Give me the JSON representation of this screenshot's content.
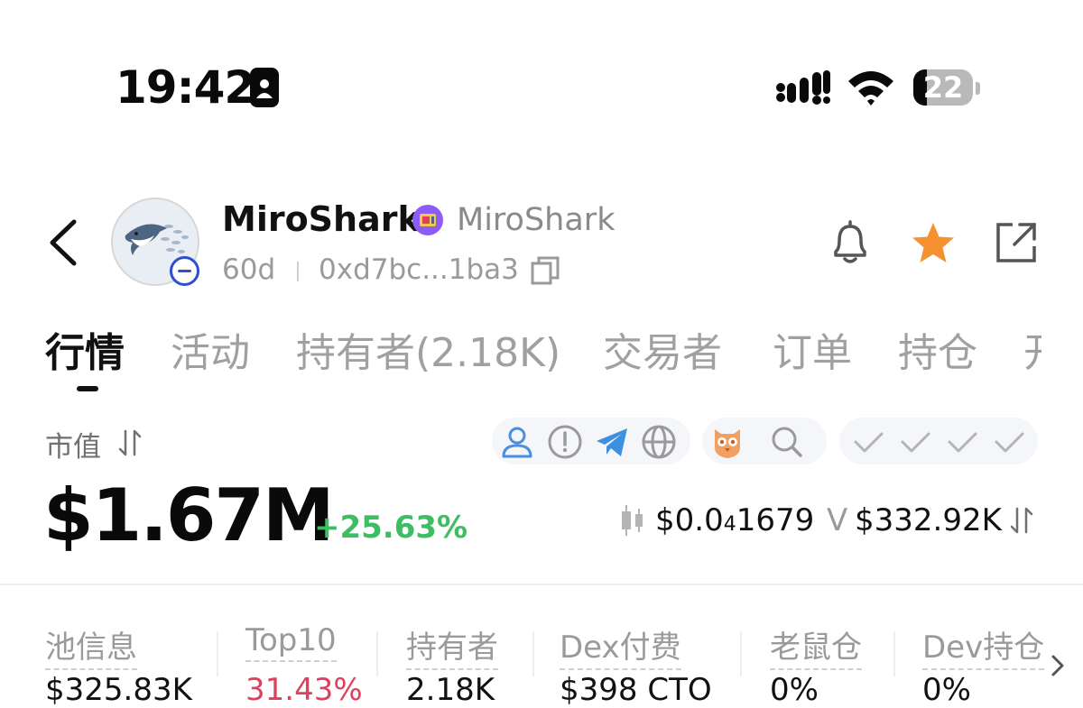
{
  "status_bar": {
    "time": "19:42",
    "battery_level": "22",
    "battery_fraction": 0.22,
    "icons": [
      "person-badge-icon",
      "signal-icon",
      "wifi-icon",
      "battery-icon"
    ]
  },
  "header": {
    "token_name": "MiroShark",
    "token_symbol": "MiroShark",
    "age": "60d",
    "address": "0xd7bc...1ba3",
    "icons": [
      "back-icon",
      "shark-avatar",
      "verified-icon",
      "copy-icon",
      "bell-icon",
      "star-icon",
      "share-icon"
    ],
    "star_color": "#f5922f"
  },
  "tabs": [
    {
      "label": "行情",
      "active": true
    },
    {
      "label": "活动",
      "active": false
    },
    {
      "label": "持有者(2.18K)",
      "active": false
    },
    {
      "label": "交易者",
      "active": false
    },
    {
      "label": "订单",
      "active": false
    },
    {
      "label": "持仓",
      "active": false
    },
    {
      "label": "开",
      "active": false
    }
  ],
  "market": {
    "mcap_label": "市值",
    "mcap_value": "$1.67M",
    "change": "+25.63%",
    "change_color": "#3dbd64",
    "price_prefix": "$0.0",
    "price_sub": "4",
    "price_digits": "1679",
    "volume_label": "V",
    "volume_value": "$332.92K",
    "link_icons": [
      "user-icon",
      "alert-icon",
      "telegram-icon",
      "globe-icon",
      "owl-icon",
      "search-icon"
    ],
    "check_icons": [
      "check-icon",
      "check-icon",
      "check-icon",
      "check-icon"
    ]
  },
  "stats": [
    {
      "label": "池信息",
      "value": "$325.83K"
    },
    {
      "label": "Top10",
      "value": "31.43%",
      "highlight": "#e0405e"
    },
    {
      "label": "持有者",
      "value": "2.18K"
    },
    {
      "label": "Dex付费",
      "value": "$398 CTO"
    },
    {
      "label": "老鼠仓",
      "value": "0%"
    },
    {
      "label": "Dev持仓",
      "value": "0%"
    }
  ]
}
